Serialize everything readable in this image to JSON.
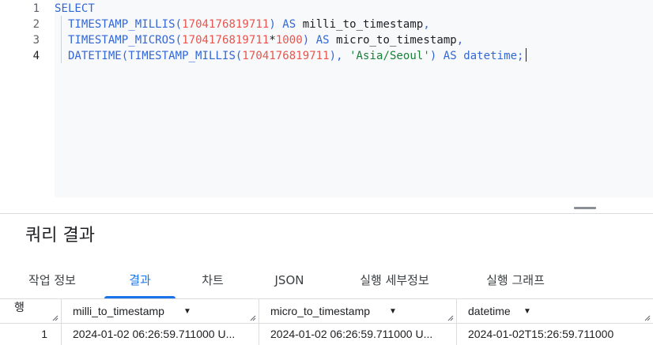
{
  "editor": {
    "line_numbers": [
      "1",
      "2",
      "3",
      "4"
    ],
    "lines": [
      [
        {
          "t": "SELECT",
          "c": "kw"
        }
      ],
      [
        {
          "t": "  TIMESTAMP_MILLIS(",
          "c": "fn"
        },
        {
          "t": "1704176819711",
          "c": "num"
        },
        {
          "t": ") AS ",
          "c": "kw"
        },
        {
          "t": "milli_to_timestamp",
          "c": "ident"
        },
        {
          "t": ",",
          "c": "punc"
        }
      ],
      [
        {
          "t": "  TIMESTAMP_MICROS(",
          "c": "fn"
        },
        {
          "t": "1704176819711",
          "c": "num"
        },
        {
          "t": "*",
          "c": "op"
        },
        {
          "t": "1000",
          "c": "num"
        },
        {
          "t": ") AS ",
          "c": "kw"
        },
        {
          "t": "micro_to_timestamp",
          "c": "ident"
        },
        {
          "t": ",",
          "c": "punc"
        }
      ],
      [
        {
          "t": "  DATETIME(TIMESTAMP_MILLIS(",
          "c": "fn"
        },
        {
          "t": "1704176819711",
          "c": "num"
        },
        {
          "t": "), ",
          "c": "punc"
        },
        {
          "t": "'Asia/Seoul'",
          "c": "str"
        },
        {
          "t": ") AS datetime;",
          "c": "kw"
        }
      ]
    ]
  },
  "results": {
    "title": "쿼리 결과",
    "tabs": [
      {
        "label": "작업 정보",
        "active": false
      },
      {
        "label": "결과",
        "active": true
      },
      {
        "label": "차트",
        "active": false
      },
      {
        "label": "JSON",
        "active": false
      },
      {
        "label": "실행 세부정보",
        "active": false
      },
      {
        "label": "실행 그래프",
        "active": false
      }
    ],
    "columns": {
      "row": "행",
      "milli": "milli_to_timestamp",
      "micro": "micro_to_timestamp",
      "datetime": "datetime"
    },
    "rows": [
      {
        "row": "1",
        "milli": "2024-01-02 06:26:59.711000 U...",
        "micro": "2024-01-02 06:26:59.711000 U...",
        "datetime": "2024-01-02T15:26:59.711000"
      }
    ]
  }
}
